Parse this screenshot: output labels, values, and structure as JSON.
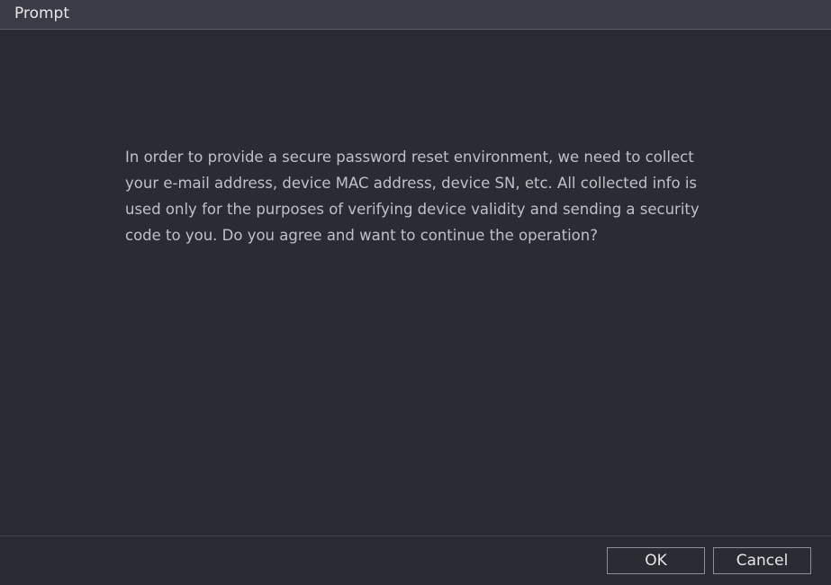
{
  "dialog": {
    "title": "Prompt",
    "message": "In order to provide a secure password reset environment, we need to collect your e-mail address, device MAC address, device SN, etc. All collected info is used only for the purposes of verifying device validity and sending a security code to you. Do you agree and want to continue the operation?",
    "ok_label": "OK",
    "cancel_label": "Cancel"
  },
  "colors": {
    "background": "#2a2b33",
    "titlebar": "#3a3b44",
    "text": "#c0c1c6",
    "button_border": "#8e8f96"
  }
}
